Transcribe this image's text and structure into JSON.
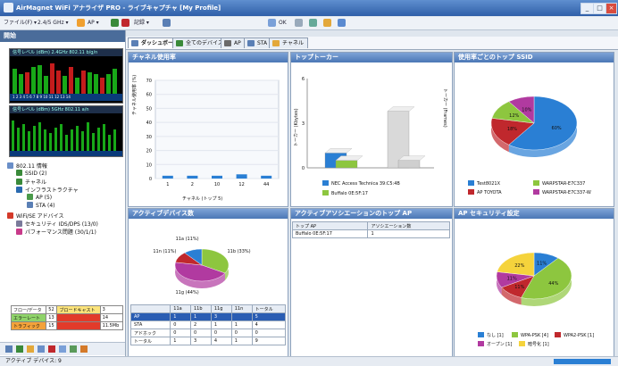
{
  "window": {
    "title": "AirMagnet WiFi アナライザ PRO - ライブキャプチャ [My Profile]",
    "buttons": [
      "_",
      "□",
      "×"
    ]
  },
  "toolbar": {
    "items": [
      "ファイル(F) ▾",
      "2.4/5 GHz ▾",
      "AP ▾",
      "開始 ▾",
      "停止",
      "記録 ▾"
    ],
    "zoom_label": "OK"
  },
  "left": {
    "header": "開始",
    "mini1_title": "信号レベル (dBm)  2.4GHz 802.11 b/g/n",
    "mini2_title": "信号レベル (dBm)  5GHz 802.11 a/n",
    "mini1_channels": "1 2 3 4 5 6 7 8 9 10 11 12 13 14",
    "tree": [
      "802.11 情報",
      "SSID (2)",
      "チャネル",
      "インフラストラクチャ",
      "AP (5)",
      "STA (4)",
      "WiFi/SE アドバイス",
      "セキュリティ IDS/DPS (13/0)",
      "パフォーマンス問題 (30/1/1)"
    ],
    "summary": [
      [
        "フロー/データ",
        "52",
        "ブロードキャスト",
        "3"
      ],
      [
        "エラーレート",
        "13",
        "",
        "14"
      ],
      [
        "トラフィック",
        "15",
        "",
        "11.5Mb"
      ]
    ]
  },
  "tabs": [
    "ダッシュボード",
    "全てのデバイス",
    "AP",
    "STA",
    "チャネル"
  ],
  "panels": {
    "channel_usage": {
      "title": "チャネル使用率",
      "ylabel": "チャネル使用率 (%)",
      "xlabel": "チャネル (トップ 5)"
    },
    "top_talkers": {
      "title": "トップトーカー",
      "ylabel_left": "トーカー (Kbytes)",
      "ylabel_right": "トーカー (Frames)"
    },
    "ssid_usage": {
      "title": "使用率ごとのトップ SSID"
    },
    "active_devices": {
      "title": "アクティブデバイス数",
      "table_header": [
        "",
        "11a",
        "11b",
        "11g",
        "11n",
        "トータル"
      ],
      "table_rows": [
        [
          "AP",
          "1",
          "1",
          "3",
          "",
          "5"
        ],
        [
          "STA",
          "0",
          "2",
          "1",
          "1",
          "4"
        ],
        [
          "アドホック",
          "0",
          "0",
          "0",
          "0",
          "0"
        ],
        [
          "トータル",
          "1",
          "3",
          "4",
          "1",
          "9"
        ]
      ]
    },
    "top_ap": {
      "title": "アクティブアソシエーションのトップ AP",
      "table_header": [
        "トップ AP",
        "アソシエーション数"
      ],
      "table_rows": [
        [
          "Buffalo 0E:5F:17",
          "1"
        ]
      ]
    },
    "ap_security": {
      "title": "AP セキュリティ設定"
    }
  },
  "status": {
    "text": "アクティブ デバイス: 9"
  },
  "colors": {
    "panel_header": "#4b77b5",
    "accent_blue": "#2a7fd4",
    "green": "#8dc63f",
    "red": "#c0282d",
    "purple": "#b13aa0",
    "yellow": "#f5d33c",
    "orange": "#f0a030",
    "gray": "#d9d9d9"
  },
  "chart_data": [
    {
      "type": "bar",
      "title": "チャネル使用率",
      "xlabel": "チャネル (トップ 5)",
      "ylabel": "チャネル使用率 (%)",
      "categories": [
        "1",
        "2",
        "10",
        "12",
        "44"
      ],
      "values": [
        2,
        2,
        2,
        3,
        2
      ],
      "ylim": [
        0,
        70
      ],
      "yticks": [
        0,
        10,
        20,
        30,
        40,
        50,
        60,
        70
      ]
    },
    {
      "type": "bar",
      "title": "トップトーカー",
      "ylim": [
        0,
        6
      ],
      "yticks": [
        0,
        3,
        6
      ],
      "series": [
        {
          "name": "NEC Access Technica 39:C5:4B",
          "values": [
            1,
            3.8
          ]
        },
        {
          "name": "Buffalo 0E:5F:17",
          "values": [
            0.5,
            0.5
          ]
        }
      ]
    },
    {
      "type": "pie",
      "title": "使用率ごとのトップ SSID",
      "labels": [
        "Test8021X",
        "AP TOYOTA",
        "WARPSTAR-E7C337",
        "WARPSTAR-E7C337-W"
      ],
      "values": [
        60,
        18,
        12,
        10
      ],
      "display_labels": [
        "60%",
        "18%",
        "12%",
        "10%"
      ]
    },
    {
      "type": "pie",
      "title": "アクティブデバイス数",
      "labels": [
        "11b",
        "11g",
        "11n",
        "11a"
      ],
      "values": [
        33,
        44,
        11,
        11
      ],
      "display_labels": [
        "11b (33%)",
        "11g (44%)",
        "11n (11%)",
        "11a (11%)"
      ]
    },
    {
      "type": "pie",
      "title": "AP セキュリティ設定",
      "labels": [
        "なし [1]",
        "WPA-PSK [4]",
        "WPA2-PSK [1]",
        "オープン [1]",
        "暗号化 [1]"
      ],
      "values": [
        11,
        44,
        11,
        11,
        22
      ],
      "display_labels": [
        "11%",
        "44%",
        "11%",
        "11%",
        "22%"
      ]
    }
  ]
}
